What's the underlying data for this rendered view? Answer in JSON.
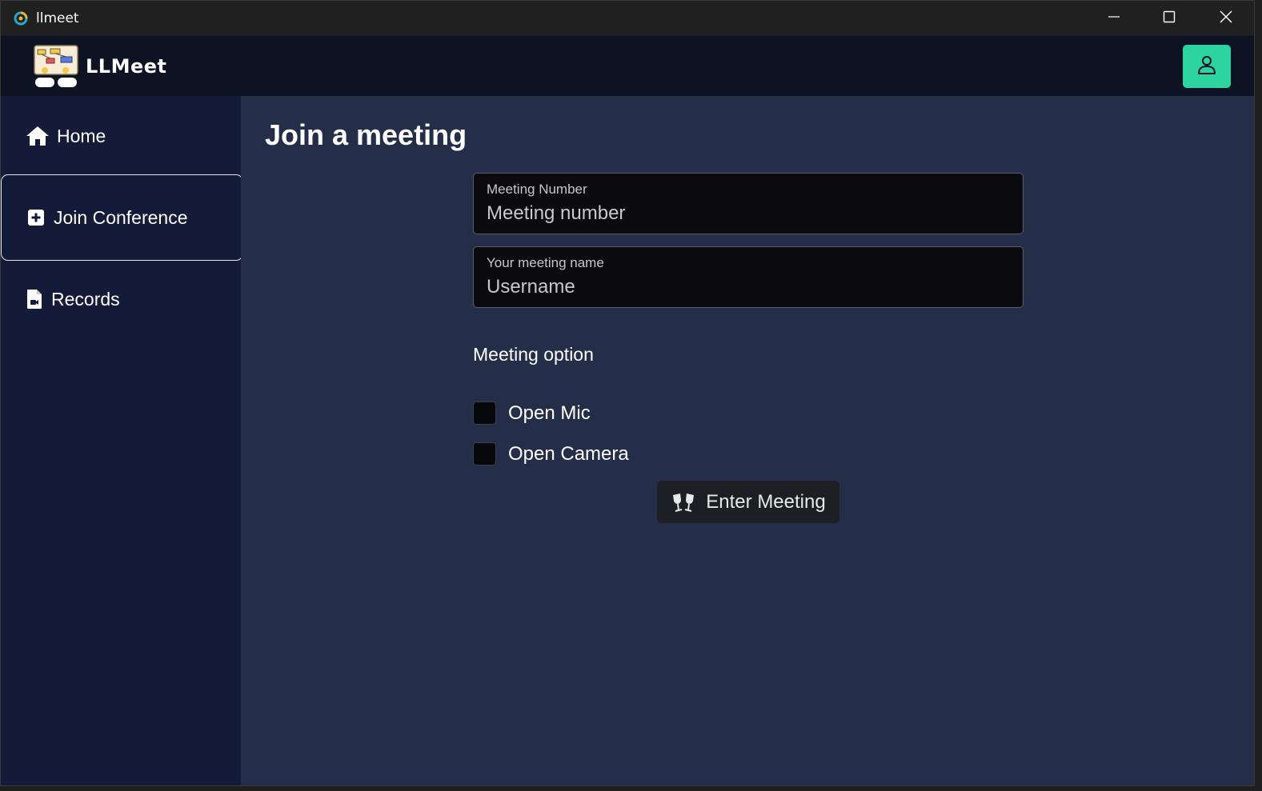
{
  "window": {
    "title": "llmeet"
  },
  "header": {
    "brand": "LLMeet"
  },
  "sidebar": {
    "items": [
      {
        "label": "Home",
        "icon": "home-icon"
      },
      {
        "label": "Join Conference",
        "icon": "plus-square-icon",
        "active": true
      },
      {
        "label": "Records",
        "icon": "file-video-icon"
      }
    ]
  },
  "main": {
    "title": "Join a meeting",
    "meeting_number": {
      "label": "Meeting Number",
      "placeholder": "Meeting number",
      "value": ""
    },
    "meeting_name": {
      "label": "Your meeting name",
      "placeholder": "Username",
      "value": ""
    },
    "options_title": "Meeting option",
    "options": [
      {
        "label": "Open Mic",
        "checked": false
      },
      {
        "label": "Open Camera",
        "checked": false
      }
    ],
    "enter_button": {
      "label": "Enter Meeting",
      "icon": "cheers-icon"
    }
  },
  "colors": {
    "accent": "#2dd4a0",
    "sidebar_bg": "#131b38",
    "main_bg": "#242e48",
    "header_bg": "#0d1322"
  }
}
